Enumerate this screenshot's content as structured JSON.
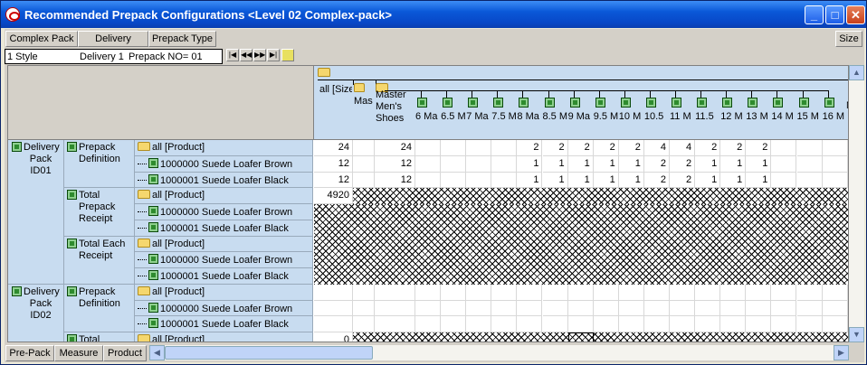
{
  "window": {
    "title": "Recommended Prepack Configurations <Level 02 Complex-pack>",
    "min": "_",
    "max": "□",
    "close": "✕"
  },
  "top_dims": [
    "Complex Pack",
    "Delivery",
    "Prepack Type"
  ],
  "size_btn": "Size",
  "header_filter": {
    "style": "1 Style",
    "delivery": "Delivery 1",
    "prepack": "Prepack NO= 01"
  },
  "nav": [
    "|◀",
    "◀◀",
    "▶▶",
    "▶|"
  ],
  "col_all": "all [Size]",
  "col_mas": "Mas",
  "col_master": "Master Men's Shoes",
  "size_cols": [
    "6 Ma",
    "6.5 M",
    "7 Ma",
    "7.5 M",
    "8 Ma",
    "8.5 M",
    "9 Ma",
    "9.5 M",
    "10 M",
    "10.5",
    "11 M",
    "11.5",
    "12 M",
    "13 M",
    "14 M",
    "15 M",
    "16 M"
  ],
  "col_trail": "M",
  "rows": {
    "dp1": "Delivery Pack ID01",
    "dp2": "Delivery Pack ID02",
    "pd": "Prepack Definition",
    "tpr": "Total Prepack Receipt",
    "ter": "Total Each Receipt",
    "tot": "Total",
    "allp": "all [Product]",
    "p1": "1000000 Suede Loafer Brown",
    "p2": "1000001 Suede Loafer Black"
  },
  "values": {
    "r1": {
      "all": "24",
      "master": "24",
      "sizes": [
        "",
        "",
        "",
        "",
        "2",
        "2",
        "2",
        "2",
        "2",
        "4",
        "4",
        "2",
        "2",
        "2",
        "",
        "",
        ""
      ]
    },
    "r2": {
      "all": "12",
      "master": "12",
      "sizes": [
        "",
        "",
        "",
        "",
        "1",
        "1",
        "1",
        "1",
        "1",
        "2",
        "2",
        "1",
        "1",
        "1",
        "",
        "",
        ""
      ]
    },
    "r3": {
      "all": "12",
      "master": "12",
      "sizes": [
        "",
        "",
        "",
        "",
        "1",
        "1",
        "1",
        "1",
        "1",
        "2",
        "2",
        "1",
        "1",
        "1",
        "",
        "",
        ""
      ]
    },
    "r4": {
      "all": "4920"
    },
    "r13": {
      "all": "0"
    }
  },
  "bottom_dims": [
    "Pre-Pack",
    "Measure",
    "Product"
  ]
}
